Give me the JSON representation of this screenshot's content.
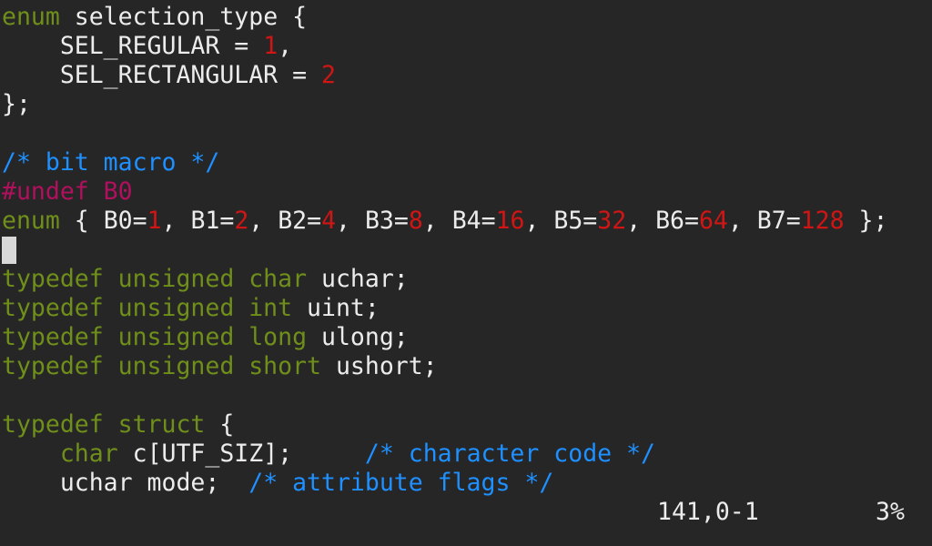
{
  "colors": {
    "background": "#262626",
    "text": "#ececec",
    "keyword": "#6f8f1a",
    "number": "#d01515",
    "comment": "#1e90ff",
    "preprocessor": "#b0105e",
    "cursor": "#d8d8d8"
  },
  "lines": [
    [
      {
        "t": "enum",
        "c": "kw"
      },
      {
        "t": " selection_type {",
        "c": "plain"
      }
    ],
    [
      {
        "t": "    SEL_REGULAR = ",
        "c": "plain"
      },
      {
        "t": "1",
        "c": "num"
      },
      {
        "t": ",",
        "c": "plain"
      }
    ],
    [
      {
        "t": "    SEL_RECTANGULAR = ",
        "c": "plain"
      },
      {
        "t": "2",
        "c": "num"
      }
    ],
    [
      {
        "t": "};",
        "c": "plain"
      }
    ],
    [],
    [
      {
        "t": "/* bit macro */",
        "c": "cmt"
      }
    ],
    [
      {
        "t": "#undef B0",
        "c": "pre"
      }
    ],
    [
      {
        "t": "enum",
        "c": "kw"
      },
      {
        "t": " { B0=",
        "c": "plain"
      },
      {
        "t": "1",
        "c": "num"
      },
      {
        "t": ", B1=",
        "c": "plain"
      },
      {
        "t": "2",
        "c": "num"
      },
      {
        "t": ", B2=",
        "c": "plain"
      },
      {
        "t": "4",
        "c": "num"
      },
      {
        "t": ", B3=",
        "c": "plain"
      },
      {
        "t": "8",
        "c": "num"
      },
      {
        "t": ", B4=",
        "c": "plain"
      },
      {
        "t": "16",
        "c": "num"
      },
      {
        "t": ", B5=",
        "c": "plain"
      },
      {
        "t": "32",
        "c": "num"
      },
      {
        "t": ", B6=",
        "c": "plain"
      },
      {
        "t": "64",
        "c": "num"
      },
      {
        "t": ", B7=",
        "c": "plain"
      },
      {
        "t": "128",
        "c": "num"
      },
      {
        "t": " };",
        "c": "plain"
      }
    ],
    [
      {
        "cursor": true
      }
    ],
    [
      {
        "t": "typedef unsigned char",
        "c": "kw"
      },
      {
        "t": " uchar;",
        "c": "plain"
      }
    ],
    [
      {
        "t": "typedef unsigned int",
        "c": "kw"
      },
      {
        "t": " uint;",
        "c": "plain"
      }
    ],
    [
      {
        "t": "typedef unsigned long",
        "c": "kw"
      },
      {
        "t": " ulong;",
        "c": "plain"
      }
    ],
    [
      {
        "t": "typedef unsigned short",
        "c": "kw"
      },
      {
        "t": " ushort;",
        "c": "plain"
      }
    ],
    [],
    [
      {
        "t": "typedef struct",
        "c": "kw"
      },
      {
        "t": " {",
        "c": "plain"
      }
    ],
    [
      {
        "t": "    ",
        "c": "plain"
      },
      {
        "t": "char",
        "c": "kw"
      },
      {
        "t": " c[UTF_SIZ];     ",
        "c": "plain"
      },
      {
        "t": "/* character code */",
        "c": "cmt"
      }
    ],
    [
      {
        "t": "    uchar mode;  ",
        "c": "plain"
      },
      {
        "t": "/* attribute flags */",
        "c": "cmt"
      }
    ]
  ],
  "status": {
    "position": "141,0-1",
    "percent": "3%"
  }
}
